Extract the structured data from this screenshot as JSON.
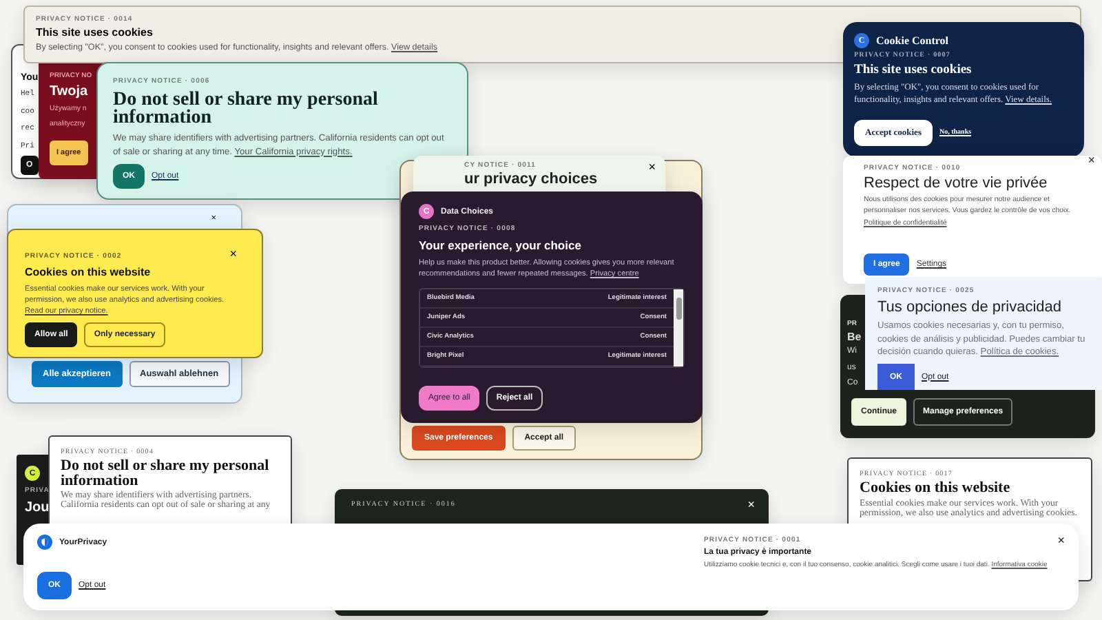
{
  "notices": [
    {
      "kind": "cream",
      "notice": "PRIVACY NOTICE · 0014",
      "title": "This site uses cookies",
      "body": {
        "text": "By selecting \"OK\", you consent to cookies used for functionality, insights and relevant offers.",
        "link": "View details"
      }
    },
    {
      "kind": "paper",
      "title": "You",
      "lines": [
        "Hel",
        "coo",
        "rec",
        "Pri"
      ],
      "buttons": [
        {
          "label": "O",
          "kind": "primary"
        }
      ]
    },
    {
      "kind": "crimson",
      "notice": "PRIVACY NO",
      "title": "Twoja",
      "lines": [
        "Używamy n",
        "analityczny"
      ],
      "buttons": [
        {
          "label": "I agree",
          "kind": "primary"
        }
      ]
    },
    {
      "kind": "mint",
      "notice": "PRIVACY NOTICE · 0006",
      "title": "Do not sell or share my personal information",
      "body": {
        "text": "We may share identifiers with advertising partners. California residents can opt out of sale or sharing at any time.",
        "link": "Your California privacy rights."
      },
      "buttons": [
        {
          "label": "OK",
          "kind": "primary"
        },
        {
          "label": "Opt out",
          "kind": "text"
        }
      ]
    },
    {
      "kind": "parchment",
      "buttons": [
        {
          "label": "Save preferences",
          "kind": "primary"
        },
        {
          "label": "Accept all",
          "kind": "secondary"
        }
      ]
    },
    {
      "kind": "sage",
      "notice": "CY NOTICE · 0011",
      "title": "ur privacy choices",
      "close": "×"
    },
    {
      "kind": "plum",
      "brand": {
        "letter": "C",
        "name": "Data Choices"
      },
      "notice": "PRIVACY NOTICE · 0008",
      "title": "Your experience, your choice",
      "body": {
        "text": "Help us make this product better. Allowing cookies gives you more relevant recommendations and fewer repeated messages.",
        "link": "Privacy centre"
      },
      "vendors": [
        {
          "name": "Bluebird Media",
          "basis": "Legitimate interest"
        },
        {
          "name": "Juniper Ads",
          "basis": "Consent"
        },
        {
          "name": "Civic Analytics",
          "basis": "Consent"
        },
        {
          "name": "Bright Pixel",
          "basis": "Legitimate interest"
        }
      ],
      "buttons": [
        {
          "label": "Agree to all",
          "kind": "primary"
        },
        {
          "label": "Reject all",
          "kind": "secondary"
        }
      ]
    },
    {
      "kind": "sky",
      "close": "×",
      "buttons": [
        {
          "label": "Alle akzeptieren",
          "kind": "primary"
        },
        {
          "label": "Auswahl ablehnen",
          "kind": "secondary"
        }
      ]
    },
    {
      "kind": "lemon",
      "close": "×",
      "notice": "PRIVACY NOTICE · 0002",
      "title": "Cookies on this website",
      "body": {
        "text": "Essential cookies make our services work. With your permission, we also use analytics and advertising cookies.",
        "link": "Read our privacy notice."
      },
      "buttons": [
        {
          "label": "Allow all",
          "kind": "primary"
        },
        {
          "label": "Only necessary",
          "kind": "secondary"
        }
      ]
    },
    {
      "kind": "navy",
      "brand": {
        "letter": "C",
        "name": "Cookie Control"
      },
      "notice": "PRIVACY NOTICE · 0007",
      "title": "This site uses cookies",
      "body": {
        "text": "By selecting \"OK\", you consent to cookies used for functionality, insights and relevant offers.",
        "link": "View details."
      },
      "buttons": [
        {
          "label": "Accept cookies",
          "kind": "primary"
        },
        {
          "label": "No, thanks",
          "kind": "text"
        }
      ]
    },
    {
      "kind": "clean",
      "close": "×",
      "notice": "PRIVACY NOTICE · 0010",
      "title": "Respect de votre vie privée",
      "body": {
        "text": "Nous utilisons des cookies pour mesurer notre audience et personnaliser nos services. Vous gardez le contrôle de vos choix.",
        "link": "Politique de confidentialité"
      },
      "buttons": [
        {
          "label": "I agree",
          "kind": "primary"
        },
        {
          "label": "Settings",
          "kind": "text"
        }
      ]
    },
    {
      "kind": "forest",
      "notice": "PR",
      "title": "Be",
      "lines": [
        "Wi",
        "us",
        "Co"
      ],
      "buttons": [
        {
          "label": "Continue",
          "kind": "primary"
        },
        {
          "label": "Manage preferences",
          "kind": "secondary"
        }
      ]
    },
    {
      "kind": "frost",
      "notice": "PRIVACY NOTICE · 0025",
      "title": "Tus opciones de privacidad",
      "body": {
        "text": "Usamos cookies necesarias y, con tu permiso, cookies de análisis y publicidad. Puedes cambiar tu decisión cuando quieras.",
        "link": "Política de cookies."
      },
      "buttons": [
        {
          "label": "OK",
          "kind": "primary"
        },
        {
          "label": "Opt out",
          "kind": "text"
        }
      ]
    },
    {
      "kind": "ink",
      "brand": {
        "letter": "C"
      },
      "notice": "PRIVA",
      "title": "Jou"
    },
    {
      "kind": "serif",
      "notice": "PRIVACY NOTICE · 0004",
      "title": "Do not sell or share my personal information",
      "body": {
        "text": "We may share identifiers with advertising partners. California residents can opt out of sale or sharing at any"
      }
    },
    {
      "kind": "serif",
      "notice": "PRIVACY NOTICE · 0017",
      "title": "Cookies on this website",
      "body": {
        "text": "Essential cookies make our services work. With your permission, we also use analytics and advertising cookies."
      }
    },
    {
      "kind": "pine",
      "notice": "PRIVACY NOTICE · 0016",
      "close": "×"
    },
    {
      "kind": "bar",
      "close": "×",
      "brand": {
        "name": "YourPrivacy"
      },
      "notice": "PRIVACY NOTICE · 0001",
      "title": "La tua privacy è importante",
      "body": {
        "text": "Utilizziamo cookie tecnici e, con il tuo consenso, cookie analitici. Scegli come usare i tuoi dati.",
        "link": "Informativa cookie"
      },
      "buttons": [
        {
          "label": "OK",
          "kind": "primary"
        },
        {
          "label": "Opt out",
          "kind": "text"
        }
      ]
    }
  ]
}
